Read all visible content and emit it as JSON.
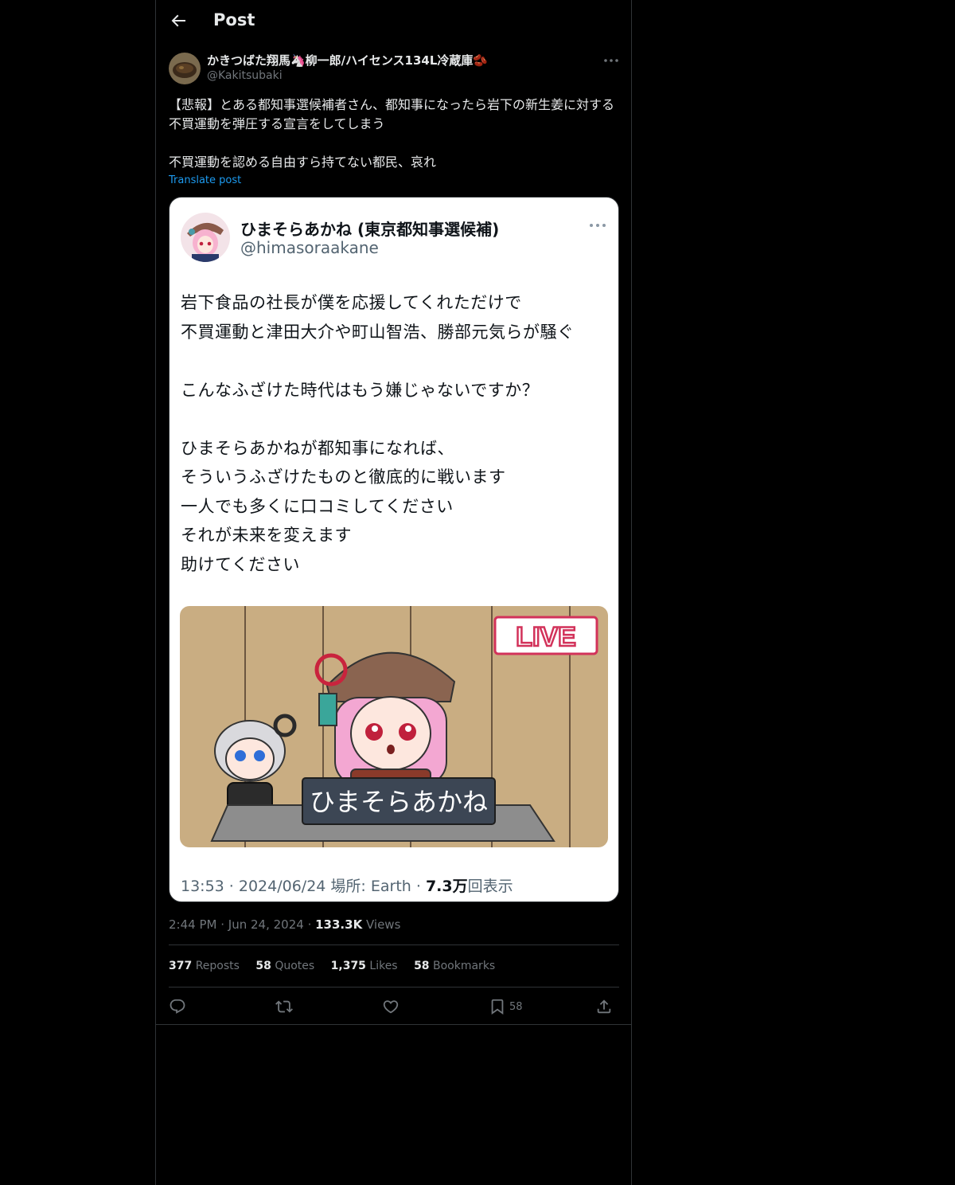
{
  "header": {
    "title": "Post",
    "back_icon": "arrow-left-icon"
  },
  "post": {
    "author_name": "かきつばた翔馬🦄柳一郎/ハイセンス134L冷蔵庫🫘",
    "author_handle": "@Kakitsubaki",
    "text": "【悲報】とある都知事選候補者さん、都知事になったら岩下の新生姜に対する不買運動を弾圧する宣言をしてしまう\n\n不買運動を認める自由すら持てない都民、哀れ",
    "translate_label": "Translate post",
    "time": "2:44 PM",
    "date": "Jun 24, 2024",
    "views_count": "133.3K",
    "views_label": "Views"
  },
  "embedded_screenshot": {
    "name": "ひまそらあかね (東京都知事選候補)",
    "handle": "@himasoraakane",
    "body": "岩下食品の社長が僕を応援してくれただけで\n不買運動と津田大介や町山智浩、勝部元気らが騒ぐ\n\nこんなふざけた時代はもう嫌じゃないですか？\n\nひまそらあかねが都知事になれば、\nそういうふざけたものと徹底的に戦います\n一人でも多くに口コミしてください\nそれが未来を変えます\n助けてください",
    "live_label": "LIVE",
    "nameplate": "ひまそらあかね",
    "meta_time": "13:53 · 2024/06/24 場所: Earth · ",
    "meta_views_num": "7.3万",
    "meta_views_label": "回表示"
  },
  "stats": {
    "reposts": {
      "count": "377",
      "label": "Reposts"
    },
    "quotes": {
      "count": "58",
      "label": "Quotes"
    },
    "likes": {
      "count": "1,375",
      "label": "Likes"
    },
    "bookmarks": {
      "count": "58",
      "label": "Bookmarks"
    }
  },
  "actions": {
    "reply_icon": "reply-icon",
    "repost_icon": "repost-icon",
    "like_icon": "heart-icon",
    "bookmark_icon": "bookmark-icon",
    "bookmark_count": "58",
    "share_icon": "share-icon"
  },
  "colors": {
    "background": "#000000",
    "border": "#2f3336",
    "link": "#1d9bf0",
    "muted": "#71767b"
  }
}
